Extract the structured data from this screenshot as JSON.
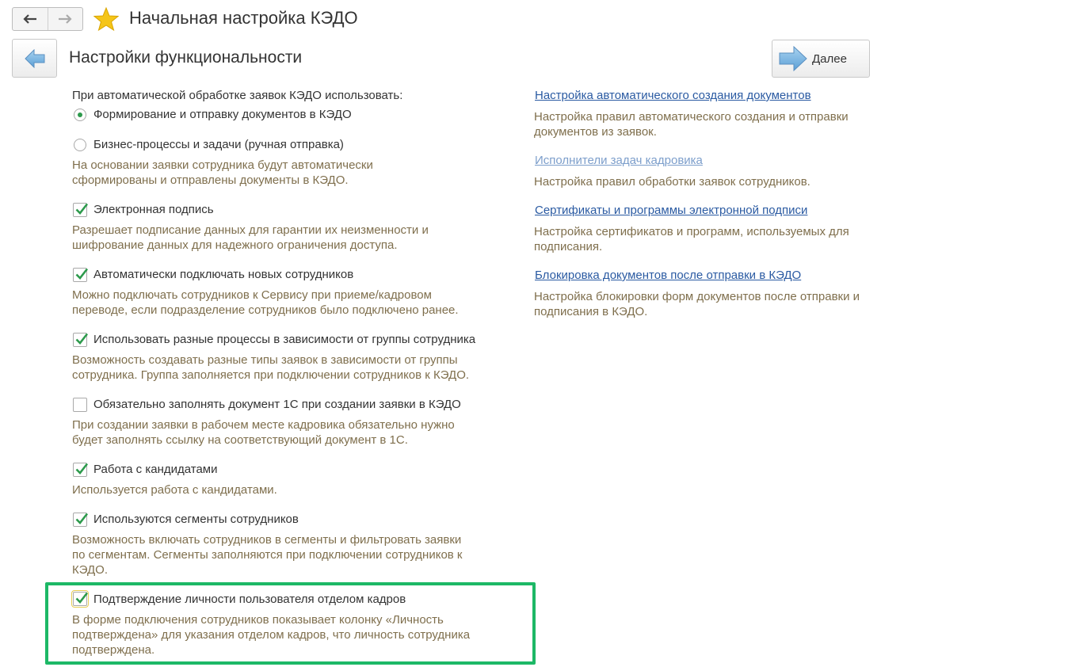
{
  "window": {
    "title": "Начальная настройка КЭДО"
  },
  "page": {
    "title": "Настройки функциональности",
    "next_label": "Далее"
  },
  "left": {
    "intro": "При автоматической обработке заявок КЭДО использовать:",
    "radios": [
      {
        "label": "Формирование и отправку документов в КЭДО",
        "selected": true
      },
      {
        "label": "Бизнес-процессы и задачи (ручная отправка)",
        "selected": false
      }
    ],
    "radio_desc": [
      "На основании заявки сотрудника будут автоматически",
      "сформированы и отправлены документы в КЭДО."
    ],
    "options": [
      {
        "label": "Электронная подпись",
        "checked": true,
        "desc": [
          "Разрешает подписание данных для гарантии их неизменности и",
          "шифрование данных для надежного ограничения доступа."
        ]
      },
      {
        "label": "Автоматически подключать новых сотрудников",
        "checked": true,
        "desc": [
          "Можно подключать сотрудников к Сервису при приеме/кадровом",
          "переводе, если подразделение сотрудников было подключено ранее."
        ]
      },
      {
        "label": "Использовать разные процессы в зависимости от группы сотрудника",
        "checked": true,
        "desc": [
          "Возможность создавать разные типы заявок в зависимости от группы",
          "сотрудника. Группа заполняется при подключении сотрудников к КЭДО."
        ]
      },
      {
        "label": "Обязательно заполнять документ 1С при создании заявки в КЭДО",
        "checked": false,
        "desc": [
          "При создании заявки в рабочем месте кадровика обязательно нужно",
          "будет заполнять ссылку на соответствующий документ в 1С."
        ]
      },
      {
        "label": "Работа с кандидатами",
        "checked": true,
        "desc": [
          "Используется работа с кандидатами."
        ]
      },
      {
        "label": "Используются сегменты сотрудников",
        "checked": true,
        "desc": [
          "Возможность включать сотрудников в сегменты и фильтровать заявки",
          "по сегментам. Сегменты заполняются при подключении сотрудников к",
          "КЭДО."
        ]
      },
      {
        "label": "Подтверждение личности пользователя отделом кадров",
        "checked": true,
        "desc": [
          "В форме подключения сотрудников показывает колонку «Личность",
          "подтверждена» для указания отделом кадров, что личность сотрудника",
          "подтверждена."
        ]
      }
    ]
  },
  "right": {
    "links": [
      {
        "label": "Настройка автоматического создания документов",
        "visited": false,
        "desc": [
          "Настройка правил автоматического создания и отправки",
          "документов из заявок."
        ]
      },
      {
        "label": "Исполнители задач кадровика",
        "visited": true,
        "desc": [
          "Настройка правил обработки заявок сотрудников."
        ]
      },
      {
        "label": "Сертификаты и программы электронной подписи",
        "visited": false,
        "desc": [
          "Настройка сертификатов и программ, используемых для",
          "подписания."
        ]
      },
      {
        "label": "Блокировка документов после отправки в КЭДО",
        "visited": false,
        "desc": [
          "Настройка блокировки форм документов после отправки и",
          "подписания в КЭДО."
        ]
      }
    ]
  },
  "colors": {
    "description_text": "#7f6f4d",
    "link": "#2a5aa2",
    "link_visited": "#7c9ecb",
    "check_green": "#2d9a4c",
    "highlight_border": "#1db866"
  }
}
